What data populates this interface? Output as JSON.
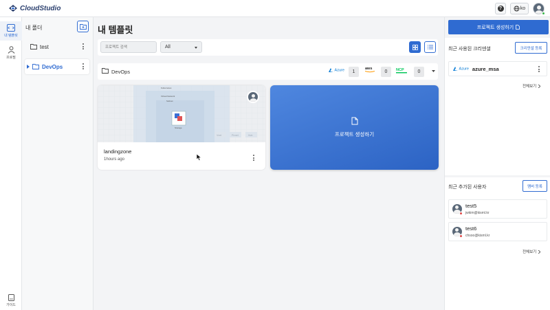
{
  "app": {
    "logo_text": "CloudStudio"
  },
  "topbar": {
    "help_label": "?",
    "lang_label": "ko"
  },
  "rail": {
    "items": [
      {
        "label": "내 템플릿",
        "active": true
      },
      {
        "label": "프로필",
        "active": false
      },
      {
        "label": "가이드",
        "active": false
      }
    ]
  },
  "folders": {
    "title": "내 폴더",
    "items": [
      {
        "name": "test",
        "active": false
      },
      {
        "name": "DevOps",
        "active": true
      }
    ]
  },
  "main": {
    "title": "내 템플릿",
    "search_placeholder": "프로젝트 검색",
    "filter_value": "All",
    "folder": {
      "name": "DevOps",
      "providers": [
        {
          "name": "Azure",
          "count": "1",
          "color": "#0078d4"
        },
        {
          "name": "aws",
          "count": "0",
          "color": "#222222"
        },
        {
          "name": "NCP",
          "count": "0",
          "color": "#03c75a"
        }
      ]
    },
    "template_card": {
      "name": "landingzone",
      "time": "1hours ago",
      "thumb_labels": [
        "Kubernetes",
        "Virtual Network",
        "Subnet",
        "Storage",
        "Vnet",
        "Pivnet",
        "Hub"
      ]
    },
    "create_card_label": "프로젝트 생성하기"
  },
  "right": {
    "cta_label": "프로젝트 생성하기",
    "credentials": {
      "title": "최근 사용된 크리덴셜",
      "button_label": "크리덴셜 등록",
      "items": [
        {
          "provider": "Azure",
          "name": "azure_msa"
        }
      ],
      "see_all": "전체보기"
    },
    "users": {
      "title": "최근 추가된 사용자",
      "button_label": "멤버 등록",
      "items": [
        {
          "name": "test5",
          "email": "jwkim@kisml.kr"
        },
        {
          "name": "test6",
          "email": "chsoo@kisml.kr"
        }
      ],
      "see_all": "전체보기"
    }
  },
  "colors": {
    "accent": "#2f6bd1",
    "online": "#39b54a",
    "offline": "#e04848"
  }
}
